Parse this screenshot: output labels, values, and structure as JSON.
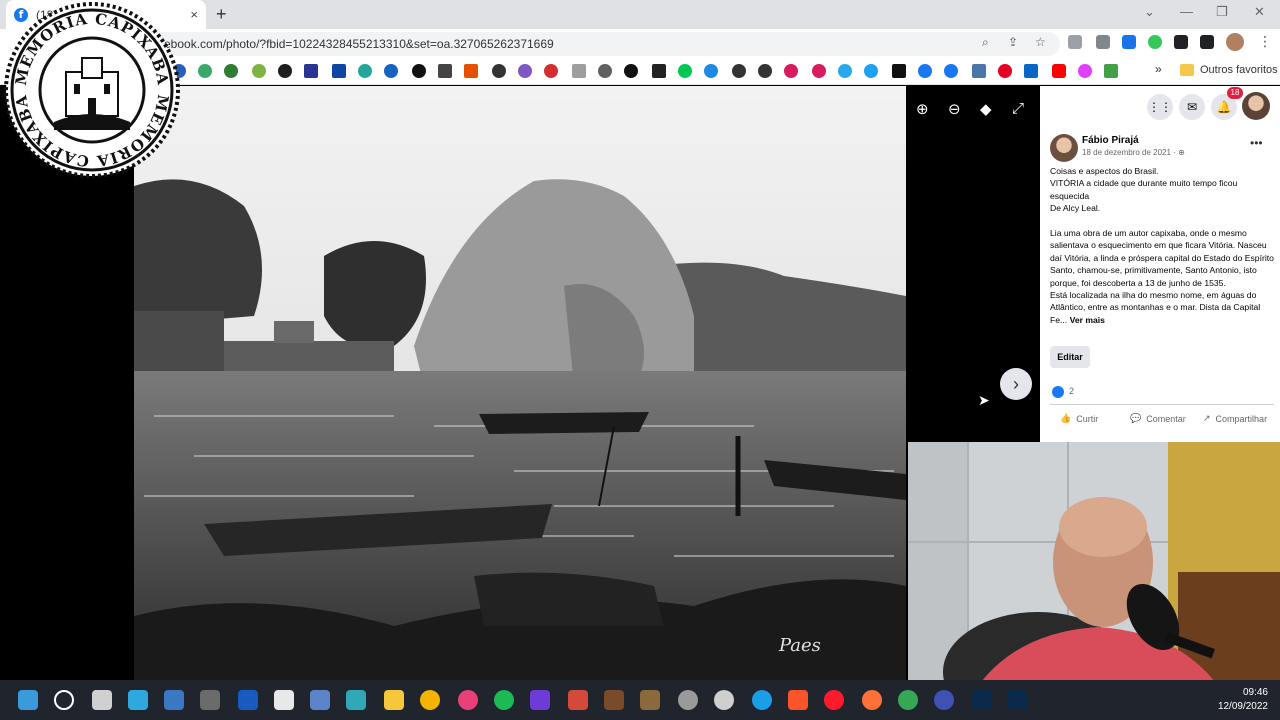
{
  "browser": {
    "tab_badge": "(18)",
    "tab_close": "×",
    "new_tab": "+",
    "url": "ebook.com/photo/?fbid=10224328455213310&set=oa.327065262371669",
    "bookmarks_folder_label": "Outros favoritos",
    "bookmarks_more": "»"
  },
  "stamp": {
    "text_top": "MEMORIA CAPIXABA",
    "text_bottom": "MEMORIA CAPIXABA"
  },
  "photo": {
    "signature": "Paes"
  },
  "viewer": {
    "zoom_in_icon": "⊕",
    "zoom_out_icon": "⊖",
    "tag_icon": "◆",
    "fullscreen_icon": "⤢",
    "next_icon": "›"
  },
  "facebook": {
    "notification_count": "18",
    "author": "Fábio Pirajá",
    "date": "18 de dezembro de 2021 · ⊕",
    "post": {
      "p1": "Coisas e aspectos do Brasil.",
      "p2": "VITÓRIA a cidade que durante muito tempo ficou esquecida",
      "p3": "De Alcy Leal.",
      "p4": "Lia uma obra de um autor capixaba, onde o mesmo salientava o esquecimento em que ficara Vitória. Nasceu daí Vitória, a linda e próspera capital do Estado do Espírito Santo, chamou-se, primitivamente, Santo Antonio, isto porque, foi descoberta a 13 de junho de 1535.",
      "p5": "Está localizada na ilha do mesmo nome, em águas do Atlântico, entre as montanhas e o mar. Dista da Capital Fe...",
      "see_more": "Ver mais"
    },
    "edit_label": "Editar",
    "likes": "2",
    "like_label": "Curtir",
    "comment_label": "Comentar",
    "share_label": "Compartilhar"
  },
  "taskbar": {
    "time": "09:46",
    "date": "12/09/2022"
  }
}
